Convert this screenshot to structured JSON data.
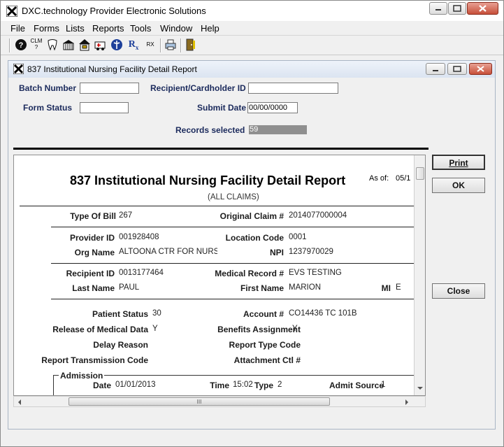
{
  "app": {
    "title": "DXC.technology Provider Electronic Solutions"
  },
  "menus": [
    "File",
    "Forms",
    "Lists",
    "Reports",
    "Tools",
    "Window",
    "Help"
  ],
  "toolbar": {
    "icons": [
      "help-icon",
      "claim-icon",
      "dental-icon",
      "building-icon",
      "house-icon",
      "ambulance-icon",
      "caduceus-icon",
      "rx-icon",
      "rx-small-icon",
      "print-icon",
      "exit-icon"
    ],
    "clm_label": "CLM",
    "rx_label": "R",
    "rx_small": "RX"
  },
  "child": {
    "title": "837 Institutional Nursing Facility  Detail Report"
  },
  "form": {
    "batch_label": "Batch Number",
    "batch_value": "",
    "recipient_label": "Recipient/Cardholder ID",
    "recipient_value": "",
    "status_label": "Form Status",
    "status_value": "",
    "submit_label": "Submit Date",
    "submit_value": "00/00/0000",
    "records_label": "Records selected",
    "records_value": "59"
  },
  "buttons": {
    "print": "Print",
    "ok": "OK",
    "close": "Close"
  },
  "report": {
    "title": "837 Institutional Nursing Facility Detail Report",
    "subtitle": "(ALL CLAIMS)",
    "asof_label": "As of:",
    "asof_value": "05/1",
    "type_of_bill_label": "Type Of Bill",
    "type_of_bill": "267",
    "orig_claim_label": "Original Claim #",
    "orig_claim": "2014077000004",
    "provider_id_label": "Provider ID",
    "provider_id": "001928408",
    "location_code_label": "Location Code",
    "location_code": "0001",
    "org_name_label": "Org Name",
    "org_name": "ALTOONA CTR FOR NURSII",
    "npi_label": "NPI",
    "npi": "1237970029",
    "recipient_id_label": "Recipient ID",
    "recipient_id": "0013177464",
    "medical_record_label": "Medical Record #",
    "medical_record": "EVS TESTING",
    "last_name_label": "Last Name",
    "last_name": "PAUL",
    "first_name_label": "First Name",
    "first_name": "MARION",
    "mi_label": "MI",
    "mi": "E",
    "patient_status_label": "Patient Status",
    "patient_status": "30",
    "account_label": "Account #",
    "account": "CO14436 TC 101B",
    "release_label": "Release of Medical Data",
    "release": "Y",
    "benefits_label": "Benefits Assignment",
    "benefits": "Y",
    "delay_label": "Delay Reason",
    "delay": "",
    "report_type_label": "Report Type Code",
    "report_type": "",
    "transmission_label": "Report Transmission Code",
    "transmission": "",
    "attachment_label": "Attachment Ctl #",
    "attachment": "",
    "admission_label": "Admission",
    "date_label": "Date",
    "date": "01/01/2013",
    "time_label": "Time",
    "time": "15:02",
    "type_label": "Type",
    "type": "2",
    "admit_source_label": "Admit Source",
    "admit_source": "1"
  },
  "scroll": {
    "grip": "III"
  }
}
